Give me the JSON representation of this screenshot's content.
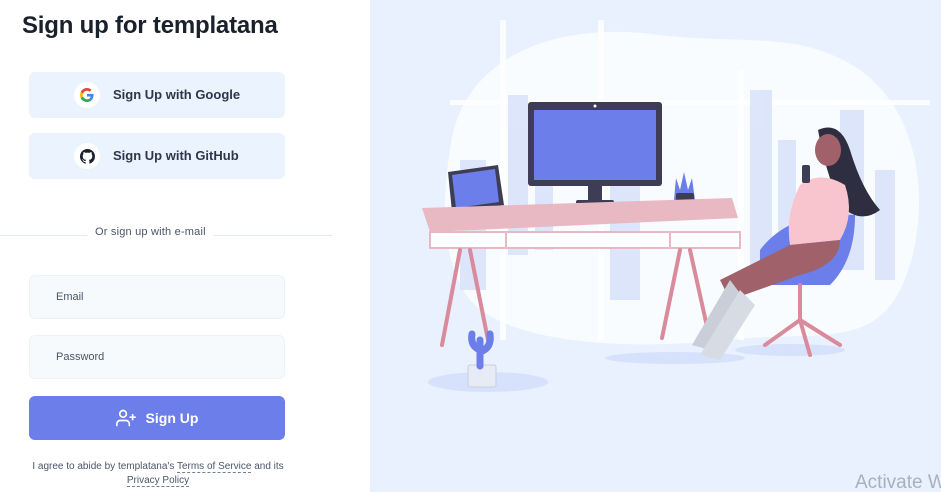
{
  "page": {
    "title": "Sign up for templatana"
  },
  "oauth": {
    "google_label": "Sign Up with Google",
    "github_label": "Sign Up with GitHub"
  },
  "divider": {
    "text": "Or sign up with e-mail"
  },
  "form": {
    "email_placeholder": "Email",
    "password_placeholder": "Password",
    "submit_label": "Sign Up"
  },
  "terms": {
    "prefix": "I agree to abide by templatana's",
    "tos_link": "Terms of Service",
    "middle": "and its",
    "privacy_link": "Privacy Policy"
  },
  "watermark": {
    "text": "Activate W"
  },
  "colors": {
    "accent": "#6b7ee9",
    "oauth_bg": "#eaf3fe",
    "illustration_bg": "#e8f1fd"
  },
  "icons": [
    "google-icon",
    "github-icon",
    "user-plus-icon",
    "desk-illustration"
  ]
}
